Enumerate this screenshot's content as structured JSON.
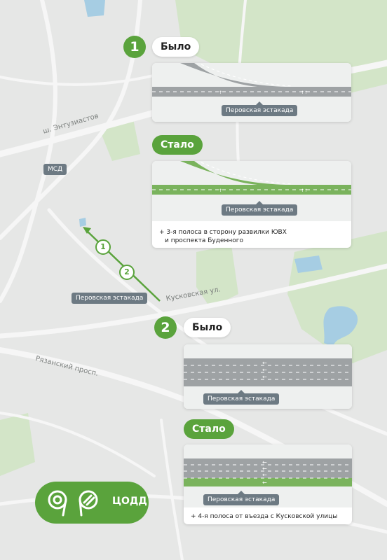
{
  "map": {
    "road_labels": {
      "entuziastov": "ш. Энтузиастов",
      "kuskovskaya": "Кусковская ул.",
      "ryazansky": "Рязанский просп."
    },
    "map_tags": {
      "msd": "МСД",
      "perovskaya": "Перовская эстакада"
    },
    "route_markers": [
      "1",
      "2"
    ],
    "colors": {
      "accent": "#5aa33c",
      "park": "#cfe3c4",
      "water": "#a6cde3",
      "tag": "#6d7a83"
    }
  },
  "section1": {
    "number": "1",
    "before": {
      "label": "Было",
      "tag": "Перовская эстакада"
    },
    "after": {
      "label": "Стало",
      "tag": "Перовская эстакада",
      "note_line1": "+ 3-я полоса в сторону развилки ЮВХ",
      "note_line2": "и проспекта Буденного"
    }
  },
  "section2": {
    "number": "2",
    "before": {
      "label": "Было",
      "tag": "Перовская эстакада"
    },
    "after": {
      "label": "Стало",
      "tag": "Перовская эстакада",
      "note": "+ 4-я полоса от въезда с Кусковской улицы"
    }
  },
  "logo": {
    "text": "ЦОДД"
  }
}
